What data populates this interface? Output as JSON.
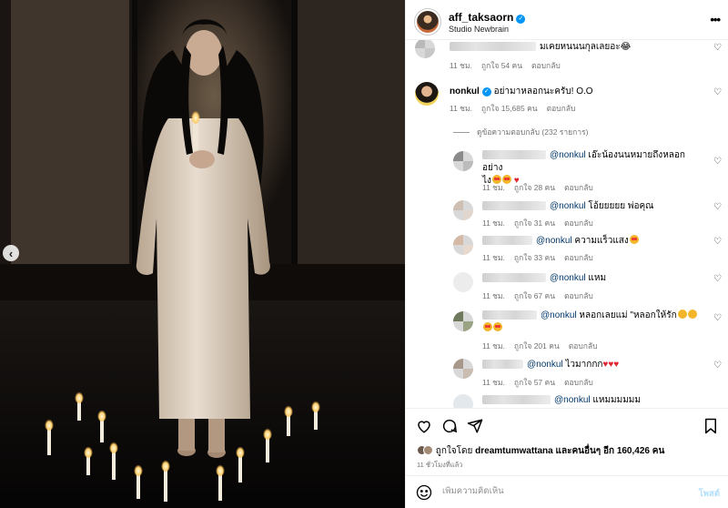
{
  "post": {
    "username": "aff_taksaorn",
    "location": "Studio Newbrain",
    "more_label": "•••"
  },
  "comments": [
    {
      "id": "c0",
      "username_blurred": true,
      "text": "มเคยหนนนกุลเลยอะ😂",
      "time": "11 ชม.",
      "likes": "ถูกใจ 54 คน",
      "reply": "ตอบกลับ"
    },
    {
      "id": "c1",
      "username": "nonkul",
      "verified": true,
      "text": "อย่ามาหลอกนะครับ! O.O",
      "time": "11 ชม.",
      "likes": "ถูกใจ 15,685 คน",
      "reply": "ตอบกลับ",
      "view_replies": "ดูข้อความตอบกลับ (232 รายการ)"
    }
  ],
  "replies": [
    {
      "id": "r0",
      "mention": "@nonkul",
      "text_line1": "เอ๊ะน้องนนหมายถึงหลอกอย่าง",
      "text_line2": "ไง",
      "time": "11 ชม.",
      "likes": "ถูกใจ 28 คน",
      "reply": "ตอบกลับ"
    },
    {
      "id": "r1",
      "mention": "@nonkul",
      "text_line1": "โอ้ยยยยย พ่อคุณ",
      "time": "11 ชม.",
      "likes": "ถูกใจ 31 คน",
      "reply": "ตอบกลับ"
    },
    {
      "id": "r2",
      "mention": "@nonkul",
      "text_line1": "ความแร็วแสง",
      "time": "11 ชม.",
      "likes": "ถูกใจ 33 คน",
      "reply": "ตอบกลับ"
    },
    {
      "id": "r3",
      "mention": "@nonkul",
      "text_line1": "แหม",
      "time": "11 ชม.",
      "likes": "ถูกใจ 67 คน",
      "reply": "ตอบกลับ"
    },
    {
      "id": "r4",
      "mention": "@nonkul",
      "text_line1": "หลอกเลยแม่ \"หลอกให้รัก",
      "time": "11 ชม.",
      "likes": "ถูกใจ 201 คน",
      "reply": "ตอบกลับ"
    },
    {
      "id": "r5",
      "mention": "@nonkul",
      "text_line1": "ไวมากกก",
      "time": "11 ชม.",
      "likes": "ถูกใจ 57 คน",
      "reply": "ตอบกลับ"
    },
    {
      "id": "r6",
      "mention": "@nonkul",
      "text_line1": "แหมมมมมม"
    }
  ],
  "likes_line": {
    "prefix": "ถูกใจโดย",
    "user": "dreamtumwattana",
    "middle": "และคนอื่นๆ อีก",
    "count": "160,426",
    "suffix": "คน"
  },
  "time_ago": "11 ชั่วโมงที่แล้ว",
  "add_comment": {
    "placeholder": "เพิ่มความคิดเห็น",
    "post_label": "โพสต์"
  },
  "colors": {
    "verified": "#0095f6",
    "mention": "#00376b",
    "meta": "#737373",
    "post_disabled": "#b2dffc"
  },
  "icons": [
    "more-icon",
    "heart-icon",
    "comment-icon",
    "share-icon",
    "bookmark-icon",
    "emoji-icon",
    "chevron-left-icon",
    "verified-icon"
  ]
}
